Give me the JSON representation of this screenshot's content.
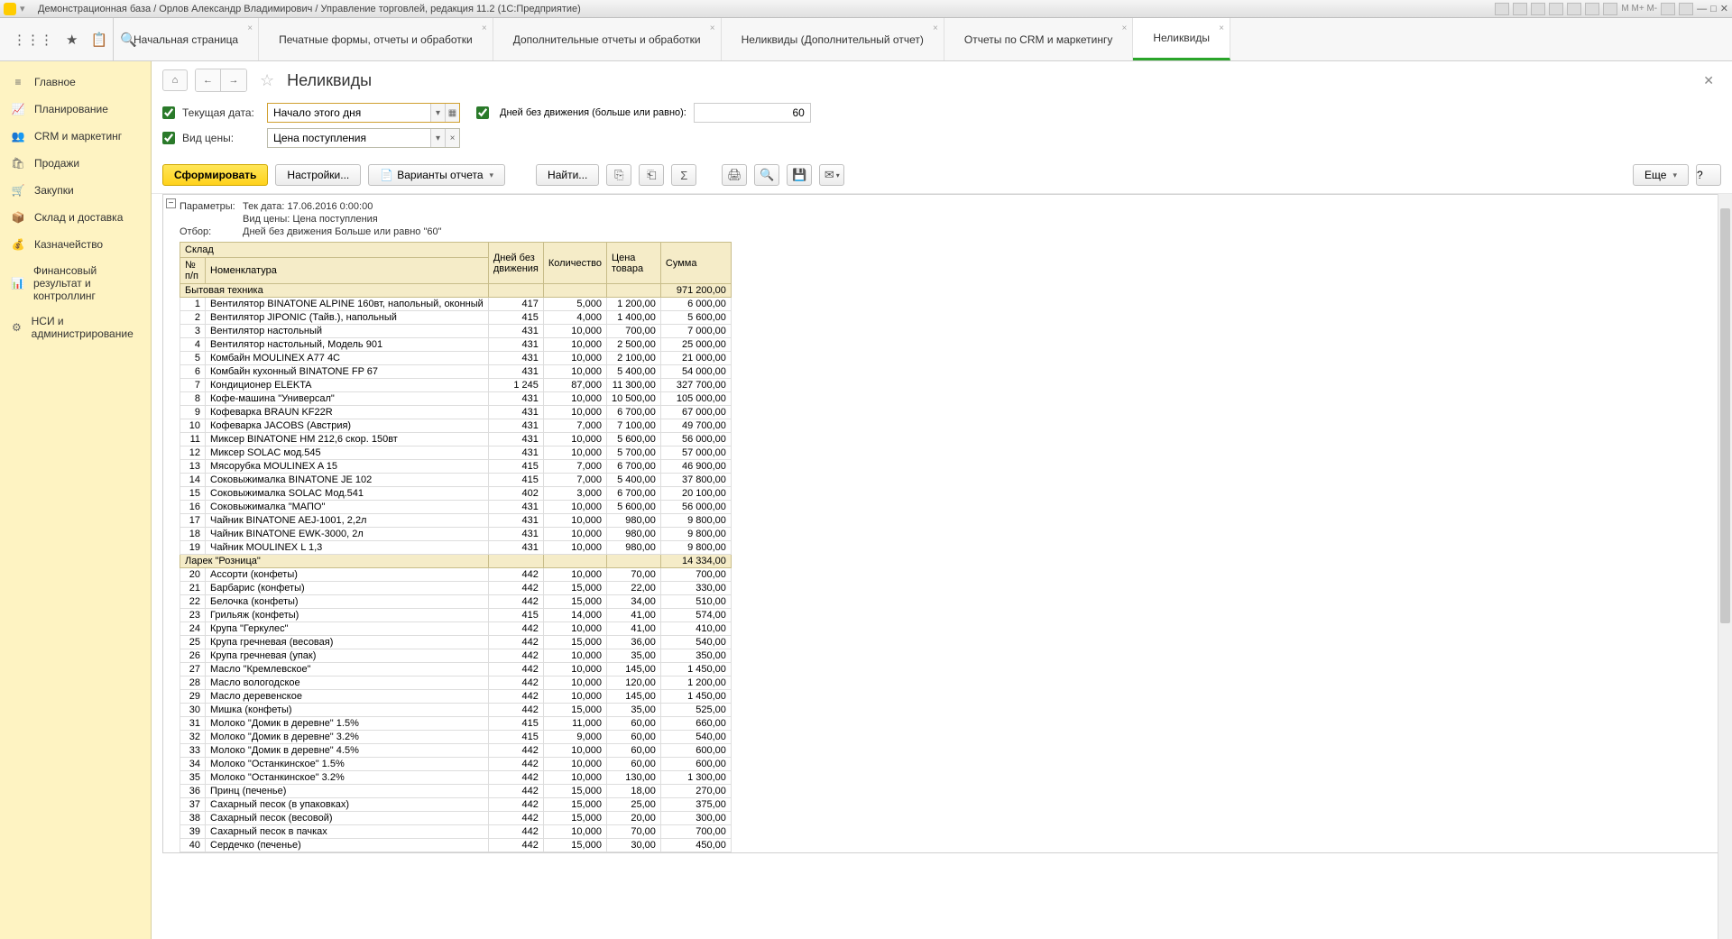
{
  "window": {
    "title": "Демонстрационная база / Орлов Александр Владимирович / Управление торговлей, редакция 11.2  (1С:Предприятие)"
  },
  "tabs": [
    {
      "label": "Начальная страница"
    },
    {
      "label": "Печатные формы, отчеты и обработки"
    },
    {
      "label": "Дополнительные отчеты и обработки"
    },
    {
      "label": "Неликвиды (Дополнительный отчет)"
    },
    {
      "label": "Отчеты по CRM и маркетингу"
    },
    {
      "label": "Неликвиды",
      "active": true
    }
  ],
  "sidebar": [
    {
      "label": "Главное",
      "icon": "≡"
    },
    {
      "label": "Планирование",
      "icon": "📈"
    },
    {
      "label": "CRM и маркетинг",
      "icon": "👥"
    },
    {
      "label": "Продажи",
      "icon": "🛍"
    },
    {
      "label": "Закупки",
      "icon": "🛒"
    },
    {
      "label": "Склад и доставка",
      "icon": "📦"
    },
    {
      "label": "Казначейство",
      "icon": "💰"
    },
    {
      "label": "Финансовый результат и контроллинг",
      "icon": "📊"
    },
    {
      "label": "НСИ и администрирование",
      "icon": "⚙"
    }
  ],
  "page": {
    "title": "Неликвиды",
    "filters": {
      "current_date_label": "Текущая дата:",
      "current_date_value": "Начало этого дня",
      "days_label": "Дней без движения (больше или равно):",
      "days_value": "60",
      "price_type_label": "Вид цены:",
      "price_type_value": "Цена поступления"
    },
    "buttons": {
      "generate": "Сформировать",
      "settings": "Настройки...",
      "variants": "Варианты отчета",
      "find": "Найти...",
      "more": "Еще",
      "help": "?"
    },
    "params": {
      "label": "Параметры:",
      "line1": "Тек дата: 17.06.2016 0:00:00",
      "line2": "Вид цены: Цена поступления",
      "filter_label": "Отбор:",
      "filter_line": "Дней без движения Больше или равно \"60\""
    },
    "headers": {
      "warehouse": "Склад",
      "n": "№ п/п",
      "nomen": "Номенклатура",
      "days": "Дней без движения",
      "qty": "Количество",
      "price": "Цена товара",
      "sum": "Сумма"
    },
    "groups": [
      {
        "title": "Бытовая техника",
        "sum": "971 200,00",
        "rows": [
          {
            "n": "1",
            "name": "Вентилятор BINATONE ALPINE 160вт, напольный, оконный",
            "days": "417",
            "qty": "5,000",
            "price": "1 200,00",
            "sum": "6 000,00"
          },
          {
            "n": "2",
            "name": "Вентилятор JIPONIC (Тайв.), напольный",
            "days": "415",
            "qty": "4,000",
            "price": "1 400,00",
            "sum": "5 600,00"
          },
          {
            "n": "3",
            "name": "Вентилятор настольный",
            "days": "431",
            "qty": "10,000",
            "price": "700,00",
            "sum": "7 000,00"
          },
          {
            "n": "4",
            "name": "Вентилятор настольный, Модель 901",
            "days": "431",
            "qty": "10,000",
            "price": "2 500,00",
            "sum": "25 000,00"
          },
          {
            "n": "5",
            "name": "Комбайн MOULINEX  A77 4C",
            "days": "431",
            "qty": "10,000",
            "price": "2 100,00",
            "sum": "21 000,00"
          },
          {
            "n": "6",
            "name": "Комбайн кухонный BINATONE FP 67",
            "days": "431",
            "qty": "10,000",
            "price": "5 400,00",
            "sum": "54 000,00"
          },
          {
            "n": "7",
            "name": "Кондиционер ELEKTA",
            "days": "1 245",
            "qty": "87,000",
            "price": "11 300,00",
            "sum": "327 700,00"
          },
          {
            "n": "8",
            "name": "Кофе-машина \"Универсал\"",
            "days": "431",
            "qty": "10,000",
            "price": "10 500,00",
            "sum": "105 000,00"
          },
          {
            "n": "9",
            "name": "Кофеварка BRAUN KF22R",
            "days": "431",
            "qty": "10,000",
            "price": "6 700,00",
            "sum": "67 000,00"
          },
          {
            "n": "10",
            "name": "Кофеварка JACOBS (Австрия)",
            "days": "431",
            "qty": "7,000",
            "price": "7 100,00",
            "sum": "49 700,00"
          },
          {
            "n": "11",
            "name": "Миксер BINATONE HM 212,6 скор. 150вт",
            "days": "431",
            "qty": "10,000",
            "price": "5 600,00",
            "sum": "56 000,00"
          },
          {
            "n": "12",
            "name": "Миксер SOLAC мод.545",
            "days": "431",
            "qty": "10,000",
            "price": "5 700,00",
            "sum": "57 000,00"
          },
          {
            "n": "13",
            "name": "Мясорубка MOULINEX  A 15",
            "days": "415",
            "qty": "7,000",
            "price": "6 700,00",
            "sum": "46 900,00"
          },
          {
            "n": "14",
            "name": "Соковыжималка  BINATONE JE 102",
            "days": "415",
            "qty": "7,000",
            "price": "5 400,00",
            "sum": "37 800,00"
          },
          {
            "n": "15",
            "name": "Соковыжималка  SOLAC  Мод.541",
            "days": "402",
            "qty": "3,000",
            "price": "6 700,00",
            "sum": "20 100,00"
          },
          {
            "n": "16",
            "name": "Соковыжималка \"МАПО\"",
            "days": "431",
            "qty": "10,000",
            "price": "5 600,00",
            "sum": "56 000,00"
          },
          {
            "n": "17",
            "name": "Чайник BINATONE  AEJ-1001,  2,2л",
            "days": "431",
            "qty": "10,000",
            "price": "980,00",
            "sum": "9 800,00"
          },
          {
            "n": "18",
            "name": "Чайник BINATONE  EWK-3000,  2л",
            "days": "431",
            "qty": "10,000",
            "price": "980,00",
            "sum": "9 800,00"
          },
          {
            "n": "19",
            "name": "Чайник MOULINEX L 1,3",
            "days": "431",
            "qty": "10,000",
            "price": "980,00",
            "sum": "9 800,00"
          }
        ]
      },
      {
        "title": "Ларек \"Розница\"",
        "sum": "14 334,00",
        "rows": [
          {
            "n": "20",
            "name": "Ассорти (конфеты)",
            "days": "442",
            "qty": "10,000",
            "price": "70,00",
            "sum": "700,00"
          },
          {
            "n": "21",
            "name": "Барбарис (конфеты)",
            "days": "442",
            "qty": "15,000",
            "price": "22,00",
            "sum": "330,00"
          },
          {
            "n": "22",
            "name": "Белочка (конфеты)",
            "days": "442",
            "qty": "15,000",
            "price": "34,00",
            "sum": "510,00"
          },
          {
            "n": "23",
            "name": "Грильяж (конфеты)",
            "days": "415",
            "qty": "14,000",
            "price": "41,00",
            "sum": "574,00"
          },
          {
            "n": "24",
            "name": "Крупа \"Геркулес\"",
            "days": "442",
            "qty": "10,000",
            "price": "41,00",
            "sum": "410,00"
          },
          {
            "n": "25",
            "name": "Крупа гречневая (весовая)",
            "days": "442",
            "qty": "15,000",
            "price": "36,00",
            "sum": "540,00"
          },
          {
            "n": "26",
            "name": "Крупа гречневая (упак)",
            "days": "442",
            "qty": "10,000",
            "price": "35,00",
            "sum": "350,00"
          },
          {
            "n": "27",
            "name": "Масло \"Кремлевское\"",
            "days": "442",
            "qty": "10,000",
            "price": "145,00",
            "sum": "1 450,00"
          },
          {
            "n": "28",
            "name": "Масло вологодское",
            "days": "442",
            "qty": "10,000",
            "price": "120,00",
            "sum": "1 200,00"
          },
          {
            "n": "29",
            "name": "Масло деревенское",
            "days": "442",
            "qty": "10,000",
            "price": "145,00",
            "sum": "1 450,00"
          },
          {
            "n": "30",
            "name": "Мишка (конфеты)",
            "days": "442",
            "qty": "15,000",
            "price": "35,00",
            "sum": "525,00"
          },
          {
            "n": "31",
            "name": "Молоко \"Домик в деревне\" 1.5%",
            "days": "415",
            "qty": "11,000",
            "price": "60,00",
            "sum": "660,00"
          },
          {
            "n": "32",
            "name": "Молоко \"Домик в деревне\" 3.2%",
            "days": "415",
            "qty": "9,000",
            "price": "60,00",
            "sum": "540,00"
          },
          {
            "n": "33",
            "name": "Молоко \"Домик в деревне\" 4.5%",
            "days": "442",
            "qty": "10,000",
            "price": "60,00",
            "sum": "600,00"
          },
          {
            "n": "34",
            "name": "Молоко \"Останкинское\" 1.5%",
            "days": "442",
            "qty": "10,000",
            "price": "60,00",
            "sum": "600,00"
          },
          {
            "n": "35",
            "name": "Молоко \"Останкинское\" 3.2%",
            "days": "442",
            "qty": "10,000",
            "price": "130,00",
            "sum": "1 300,00"
          },
          {
            "n": "36",
            "name": "Принц (печенье)",
            "days": "442",
            "qty": "15,000",
            "price": "18,00",
            "sum": "270,00"
          },
          {
            "n": "37",
            "name": "Сахарный песок (в упаковках)",
            "days": "442",
            "qty": "15,000",
            "price": "25,00",
            "sum": "375,00"
          },
          {
            "n": "38",
            "name": "Сахарный песок (весовой)",
            "days": "442",
            "qty": "15,000",
            "price": "20,00",
            "sum": "300,00"
          },
          {
            "n": "39",
            "name": "Сахарный песок в пачках",
            "days": "442",
            "qty": "10,000",
            "price": "70,00",
            "sum": "700,00"
          },
          {
            "n": "40",
            "name": "Сердечко (печенье)",
            "days": "442",
            "qty": "15,000",
            "price": "30,00",
            "sum": "450,00"
          }
        ]
      }
    ]
  }
}
